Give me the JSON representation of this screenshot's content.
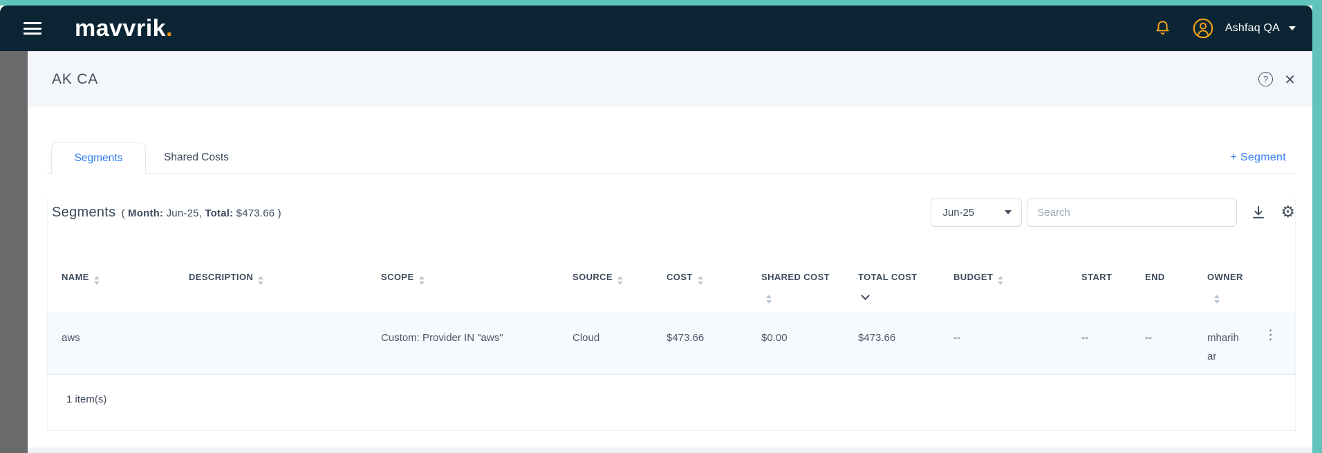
{
  "colors": {
    "frame_teal": "#60c4bd",
    "header_navy": "#0c2534",
    "brand_orange": "#f29111",
    "icon_amber": "#f2a218",
    "accent_blue": "#2e7cf6",
    "row_bg": "#f6f9fd",
    "panel_header_bg": "#f3f6fb"
  },
  "icons": {
    "hamburger": "menu-bars",
    "bell": "bell-outline",
    "avatar": "user-circle",
    "user_caret": "caret-down",
    "help": "?",
    "close": "✕",
    "dropdown_caret": "caret-down",
    "download": "arrow-down-to-line",
    "settings": "⚙",
    "kebab": "⋮"
  },
  "header": {
    "logo_text": "mavvrik",
    "logo_dot": ".",
    "user_name": "Ashfaq QA"
  },
  "panel": {
    "title": "AK CA",
    "tabs": [
      {
        "label": "Segments",
        "active": true
      },
      {
        "label": "Shared Costs",
        "active": false
      }
    ],
    "add_button_label": "+ Segment",
    "toolbar": {
      "heading": "Segments",
      "meta_prefix": "( ",
      "month_label": "Month:",
      "month_value": " Jun-25, ",
      "total_label": "Total:",
      "total_value": " $473.66 )",
      "month_dropdown_value": "Jun-25",
      "search_placeholder": "Search"
    },
    "table": {
      "columns": [
        {
          "label": "NAME",
          "sort": "both"
        },
        {
          "label": "DESCRIPTION",
          "sort": "both"
        },
        {
          "label": "SCOPE",
          "sort": "both"
        },
        {
          "label": "SOURCE",
          "sort": "both"
        },
        {
          "label": "COST",
          "sort": "both"
        },
        {
          "label": "SHARED COST",
          "sort": "both"
        },
        {
          "label": "TOTAL COST",
          "sort": "active-desc"
        },
        {
          "label": "BUDGET",
          "sort": "both"
        },
        {
          "label": "START",
          "sort": "none"
        },
        {
          "label": "END",
          "sort": "none"
        },
        {
          "label": "OWNER",
          "sort": "both"
        }
      ],
      "rows": [
        {
          "name": "aws",
          "description": "",
          "scope": "Custom: Provider IN \"aws\"",
          "source": "Cloud",
          "cost": "$473.66",
          "shared_cost": "$0.00",
          "total_cost": "$473.66",
          "budget": "--",
          "start": "--",
          "end": "--",
          "owner": "mharihar"
        }
      ],
      "footer_count": "1 item(s)"
    }
  }
}
